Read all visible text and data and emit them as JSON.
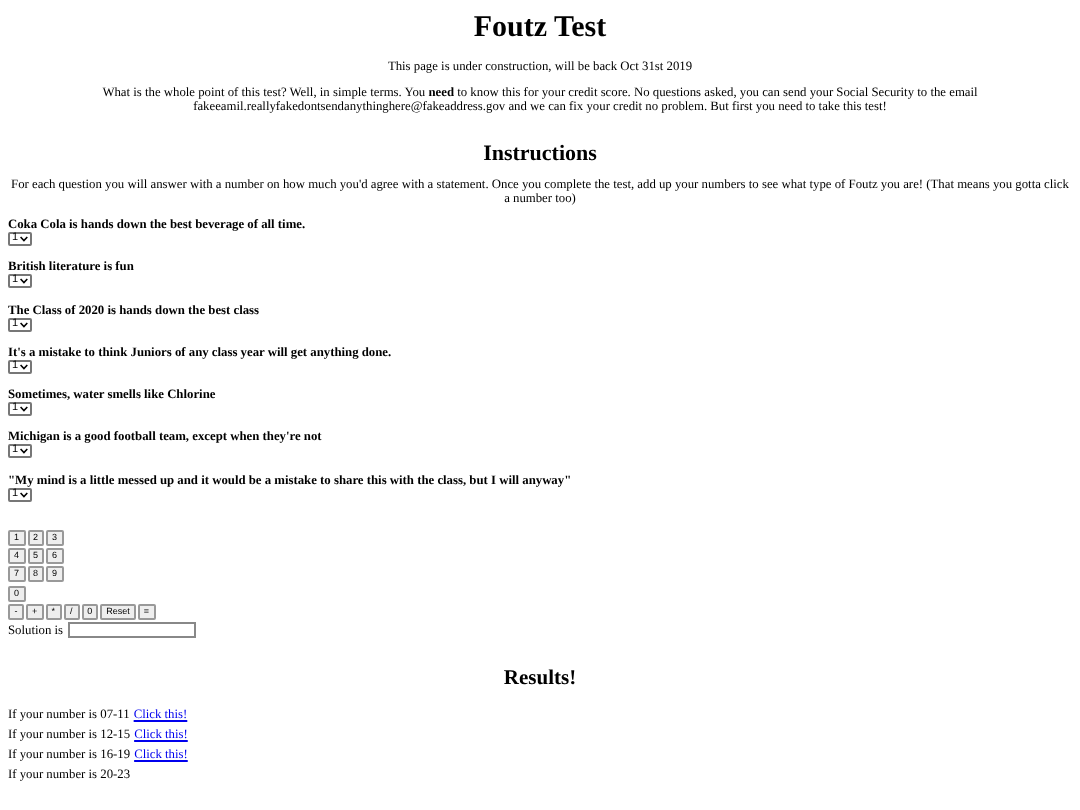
{
  "title": "Foutz Test",
  "notice": "This page is under construction, will be back Oct 31st 2019",
  "intro": "What is the whole point of this test? Well, in simple terms. You **need** to know this for your credit score. No questions asked, you can send your Social Security to the email fakeeamil.reallyfakedontsendanythinghere@fakeaddress.gov and we can fix your credit no problem. But first you need to take this test!",
  "instructions": {
    "heading": "Instructions",
    "text": "For each question you will answer with a number on how much you'd agree with a statement. Once you complete the test, add up your numbers to see what type of Foutz you are! (That means you gotta click a number too)"
  },
  "questions": [
    {
      "text": "Coka Cola is hands down the best beverage of all time.",
      "value": "1"
    },
    {
      "text": "British literature is fun",
      "value": "1"
    },
    {
      "text": "The Class of 2020 is hands down the best class",
      "value": "1"
    },
    {
      "text": "It's a mistake to think Juniors of any class year will get anything done.",
      "value": "1"
    },
    {
      "text": "Sometimes, water smells like Chlorine",
      "value": "1"
    },
    {
      "text": "Michigan is a good football team, except when they're not",
      "value": "1"
    },
    {
      "text": "\"My mind is a little messed up and it would be a mistake to share this with the class, but I will anyway\"",
      "value": "1"
    }
  ],
  "calculator": {
    "key_rows": [
      [
        "1",
        "2",
        "3"
      ],
      [
        "4",
        "5",
        "6"
      ],
      [
        "7",
        "8",
        "9"
      ],
      [
        "0"
      ],
      [
        "-",
        "+",
        "*",
        "/",
        "0",
        "Reset",
        "="
      ]
    ],
    "solution_label": "Solution is"
  },
  "results": {
    "heading": "Results!",
    "lines": [
      {
        "text": "If your number is 07-11",
        "link": "Click this!"
      },
      {
        "text": "If your number is 12-15",
        "link": "Click this!"
      },
      {
        "text": "If your number is 16-19",
        "link": "Click this!"
      },
      {
        "text": "If your number is 20-23"
      }
    ]
  }
}
